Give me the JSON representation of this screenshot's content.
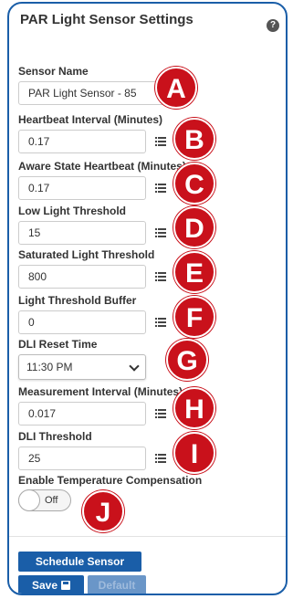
{
  "panel": {
    "title": "PAR Light Sensor Settings",
    "help_icon": "?"
  },
  "fields": [
    {
      "label": "Sensor Name",
      "value": "PAR Light Sensor - 85",
      "marker": "A"
    },
    {
      "label": "Heartbeat Interval (Minutes)",
      "value": "0.17",
      "marker": "B"
    },
    {
      "label": "Aware State Heartbeat (Minutes)",
      "value": "0.17",
      "marker": "C"
    },
    {
      "label": "Low Light Threshold",
      "value": "15",
      "marker": "D"
    },
    {
      "label": "Saturated Light Threshold",
      "value": "800",
      "marker": "E"
    },
    {
      "label": "Light Threshold Buffer",
      "value": "0",
      "marker": "F"
    },
    {
      "label": "DLI Reset Time",
      "value": "11:30 PM",
      "marker": "G"
    },
    {
      "label": "Measurement Interval (Minutes)",
      "value": "0.017",
      "marker": "H"
    },
    {
      "label": "DLI Threshold",
      "value": "25",
      "marker": "I"
    },
    {
      "label": "Enable Temperature Compensation",
      "value": "Off",
      "marker": "J"
    }
  ],
  "buttons": {
    "schedule": "Schedule Sensor",
    "save": "Save",
    "default": "Default"
  },
  "colors": {
    "brand": "#1a5ea8",
    "marker": "#c9111b"
  }
}
